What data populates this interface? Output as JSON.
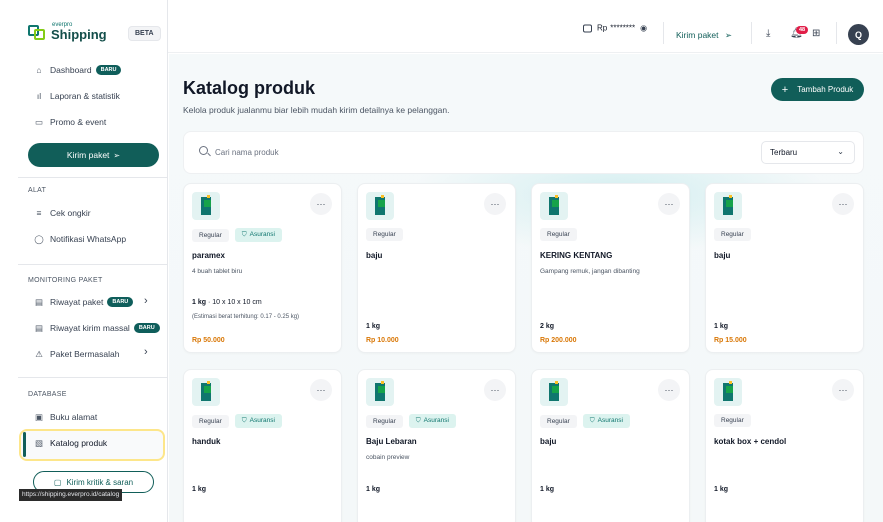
{
  "app": {
    "logo_small": "everpro",
    "logo_name": "Shipping",
    "beta": "BETA",
    "status_url": "https://shipping.everpro.id/catalog"
  },
  "sidebar": {
    "dashboard": "Dashboard",
    "new_badge": "BARU",
    "laporan": "Laporan & statistik",
    "promo": "Promo & event",
    "kirim_button": "Kirim paket",
    "section_alat": "ALAT",
    "cek_ongkir": "Cek ongkir",
    "notif_wa": "Notifikasi WhatsApp",
    "section_monitoring": "MONITORING PAKET",
    "riwayat_paket": "Riwayat paket",
    "riwayat_massal": "Riwayat kirim massal",
    "paket_bermasalah": "Paket Bermasalah",
    "section_database": "DATABASE",
    "buku_alamat": "Buku alamat",
    "katalog": "Katalog produk",
    "feedback_button": "Kirim kritik & saran"
  },
  "header": {
    "balance_label": "Rp",
    "balance_masked": "********",
    "kirim_paket": "Kirim paket",
    "notification_count": "48",
    "avatar_initial": "Q"
  },
  "main": {
    "title": "Katalog produk",
    "subtitle": "Kelola produk jualanmu biar lebih mudah kirim detailnya ke pelanggan.",
    "add_button": "Tambah Produk",
    "search_placeholder": "Cari nama produk",
    "sort_selected": "Terbaru"
  },
  "tags": {
    "regular": "Regular",
    "asuransi": "Asuransi"
  },
  "products": [
    {
      "name": "paramex",
      "desc": "4 buah tablet biru",
      "weight": "1 kg",
      "dims": "· 10 x 10 x 10 cm",
      "estimate": "(Estimasi berat terhitung: 0.17 - 0.25 kg)",
      "price": "Rp 50.000",
      "insured": true
    },
    {
      "name": "baju",
      "desc": "",
      "weight": "1 kg",
      "dims": "",
      "estimate": "",
      "price": "Rp 10.000",
      "insured": false
    },
    {
      "name": "KERING KENTANG",
      "desc": "Gampang remuk, jangan dibanting",
      "weight": "2 kg",
      "dims": "",
      "estimate": "",
      "price": "Rp 200.000",
      "insured": false
    },
    {
      "name": "baju",
      "desc": "",
      "weight": "1 kg",
      "dims": "",
      "estimate": "",
      "price": "Rp 15.000",
      "insured": false
    },
    {
      "name": "handuk",
      "desc": "",
      "weight": "1 kg",
      "dims": "",
      "estimate": "",
      "price": "",
      "insured": true
    },
    {
      "name": "Baju Lebaran",
      "desc": "cobain preview",
      "weight": "1 kg",
      "dims": "",
      "estimate": "",
      "price": "",
      "insured": true
    },
    {
      "name": "baju",
      "desc": "",
      "weight": "1 kg",
      "dims": "",
      "estimate": "",
      "price": "",
      "insured": true
    },
    {
      "name": "kotak box + cendol",
      "desc": "",
      "weight": "1 kg",
      "dims": "",
      "estimate": "",
      "price": "",
      "insured": false
    }
  ]
}
